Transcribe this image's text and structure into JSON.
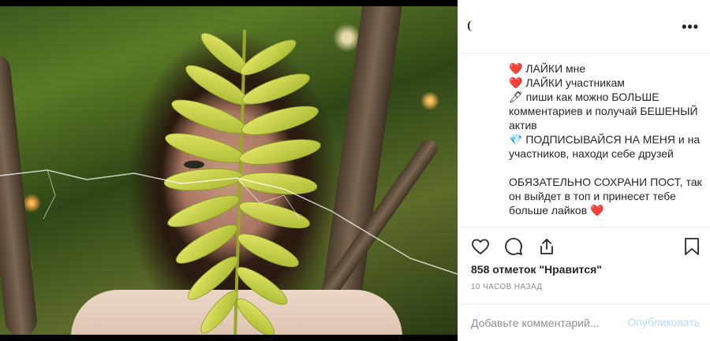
{
  "post": {
    "caption_lines": [
      "❤️ ЛАЙКИ мне",
      "❤️ ЛАЙКИ участникам",
      "🖊 пиши как можно БОЛЬШЕ",
      "комментариев и получай БЕШЕНЫЙ",
      "актив",
      "💎 ПОДПИСЫВАЙСЯ НА МЕНЯ и на",
      "участников, находи себе друзей",
      "",
      "ОБЯЗАТЕЛЬНО СОХРАНИ ПОСТ, так",
      "он выйдет в топ и принесет тебе",
      "больше лайков ❤️"
    ],
    "more_label": "•••",
    "likes_text": "858 отметок \"Нравится\"",
    "time_text": "10 ЧАСОВ НАЗАД"
  },
  "actions": {
    "like_icon": "heart-icon",
    "comment_icon": "comment-icon",
    "share_icon": "share-icon",
    "save_icon": "bookmark-icon"
  },
  "comment": {
    "placeholder": "Добавьте комментарий...",
    "post_label": "Опубликовать"
  },
  "colors": {
    "post_button_disabled": "#b3dbff",
    "muted_text": "#8e8e8e",
    "border": "#efefef"
  }
}
